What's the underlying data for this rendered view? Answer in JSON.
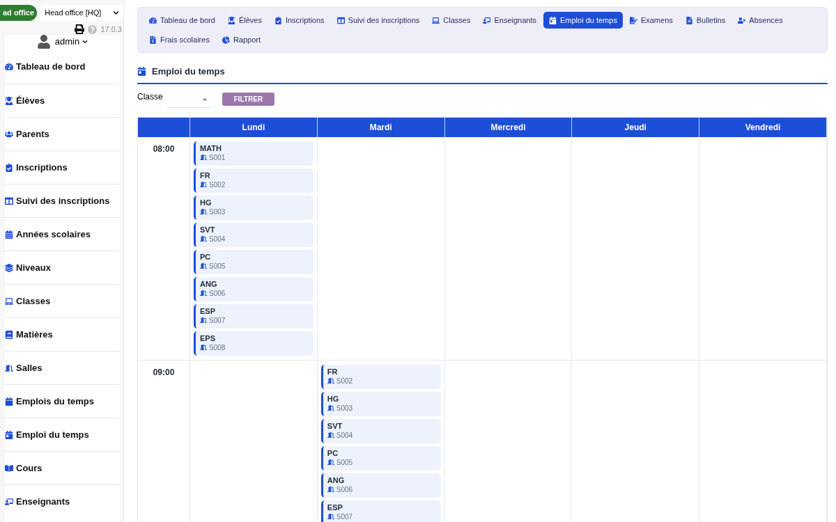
{
  "header": {
    "branch_badge": "ad office",
    "branch_select": "Head office [HQ]",
    "version": "17.0.3"
  },
  "user": {
    "name": "admin"
  },
  "sidebar": {
    "items": [
      {
        "label": "Tableau de bord"
      },
      {
        "label": "Élèves"
      },
      {
        "label": "Parents"
      },
      {
        "label": "Inscriptions"
      },
      {
        "label": "Suivi des inscriptions"
      },
      {
        "label": "Années scolaires"
      },
      {
        "label": "Niveaux"
      },
      {
        "label": "Classes"
      },
      {
        "label": "Matières"
      },
      {
        "label": "Salles"
      },
      {
        "label": "Emplois du temps"
      },
      {
        "label": "Emploi du temps"
      },
      {
        "label": "Cours"
      },
      {
        "label": "Enseignants"
      }
    ]
  },
  "nav": {
    "tabs": [
      {
        "label": "Tableau de bord",
        "selected": false
      },
      {
        "label": "Élèves",
        "selected": false
      },
      {
        "label": "Inscriptions",
        "selected": false
      },
      {
        "label": "Suivi des inscriptions",
        "selected": false
      },
      {
        "label": "Classes",
        "selected": false
      },
      {
        "label": "Enseignants",
        "selected": false
      },
      {
        "label": "Emploi du temps",
        "selected": true
      },
      {
        "label": "Examens",
        "selected": false
      },
      {
        "label": "Bulletins",
        "selected": false
      },
      {
        "label": "Absences",
        "selected": false
      },
      {
        "label": "Frais scolaires",
        "selected": false
      },
      {
        "label": "Rapport",
        "selected": false
      }
    ]
  },
  "page": {
    "title": "Emploi du temps"
  },
  "filter": {
    "label": "Classe",
    "button": "FILTRER"
  },
  "timetable": {
    "days": [
      "Lundi",
      "Mardi",
      "Mercredi",
      "Jeudi",
      "Vendredi"
    ],
    "rows": [
      {
        "time": "08:00",
        "cells": [
          [
            {
              "subject": "MATH",
              "room": "S001"
            },
            {
              "subject": "FR",
              "room": "S002"
            },
            {
              "subject": "HG",
              "room": "S003"
            },
            {
              "subject": "SVT",
              "room": "S004"
            },
            {
              "subject": "PC",
              "room": "S005"
            },
            {
              "subject": "ANG",
              "room": "S006"
            },
            {
              "subject": "ESP",
              "room": "S007"
            },
            {
              "subject": "EPS",
              "room": "S008"
            }
          ],
          [],
          [],
          [],
          []
        ]
      },
      {
        "time": "09:00",
        "cells": [
          [],
          [
            {
              "subject": "FR",
              "room": "S002"
            },
            {
              "subject": "HG",
              "room": "S003"
            },
            {
              "subject": "SVT",
              "room": "S004"
            },
            {
              "subject": "PC",
              "room": "S005"
            },
            {
              "subject": "ANG",
              "room": "S006"
            },
            {
              "subject": "ESP",
              "room": "S007"
            }
          ],
          [],
          [],
          []
        ]
      }
    ]
  }
}
